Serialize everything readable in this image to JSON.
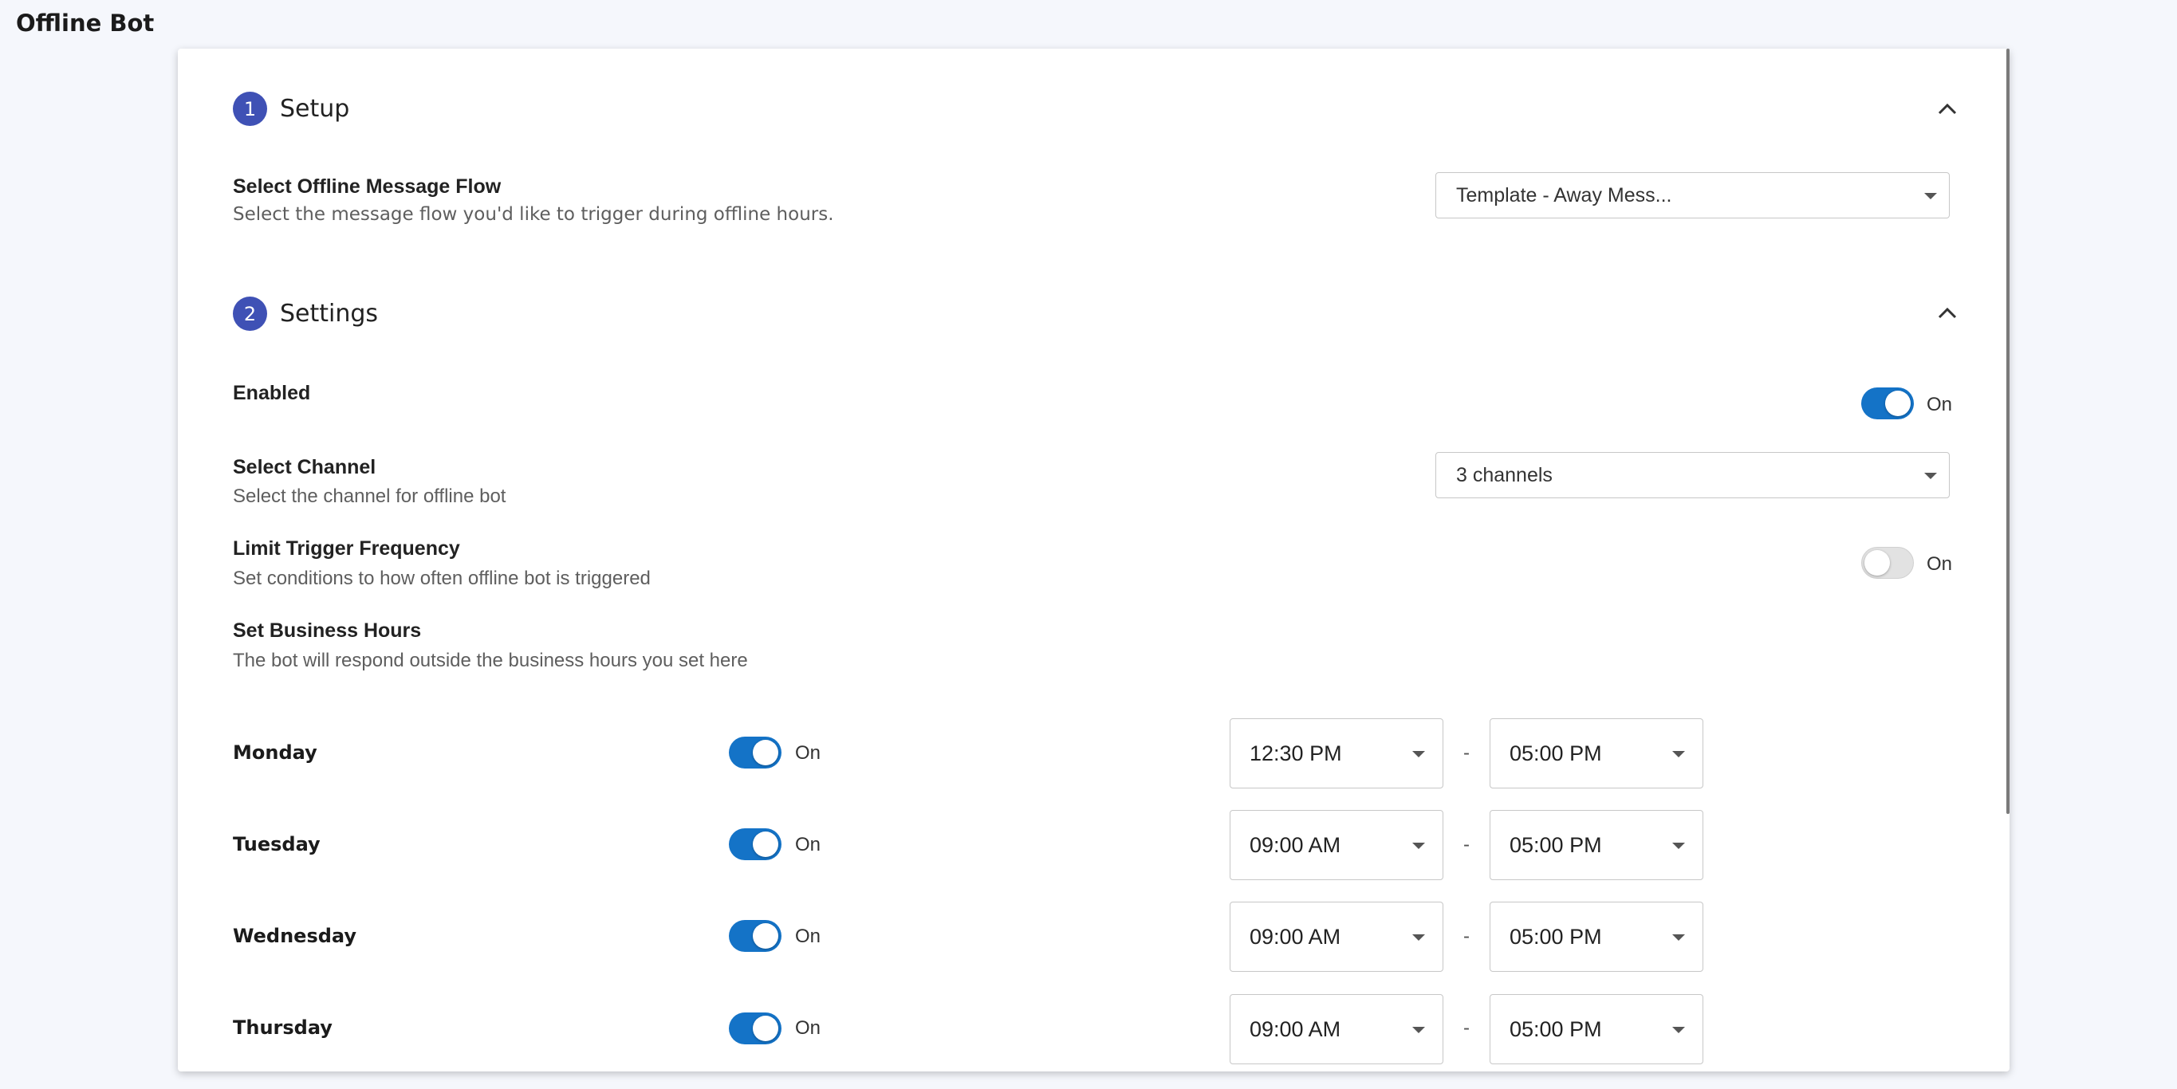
{
  "page": {
    "title": "Offline Bot"
  },
  "sections": [
    {
      "number": "1",
      "title": "Setup",
      "collapse_icon": "chevron-up-icon"
    },
    {
      "number": "2",
      "title": "Settings",
      "collapse_icon": "chevron-up-icon"
    }
  ],
  "setup": {
    "flow_label": "Select Offline Message Flow",
    "flow_desc": "Select the message flow you'd like to trigger during offline hours.",
    "flow_value": "Template - Away Mess..."
  },
  "settings": {
    "enabled_label": "Enabled",
    "enabled_state": "On",
    "channel_label": "Select Channel",
    "channel_desc": "Select the channel for offline bot",
    "channel_value": "3 channels",
    "limit_label": "Limit Trigger Frequency",
    "limit_desc": "Set conditions to how often offline bot is triggered",
    "limit_state": "On",
    "hours_label": "Set Business Hours",
    "hours_desc": "The bot will respond outside the business hours you set here"
  },
  "days": [
    {
      "name": "Monday",
      "state": "On",
      "start": "12:30 PM",
      "end": "05:00 PM",
      "separator": "-"
    },
    {
      "name": "Tuesday",
      "state": "On",
      "start": "09:00 AM",
      "end": "05:00 PM",
      "separator": "-"
    },
    {
      "name": "Wednesday",
      "state": "On",
      "start": "09:00 AM",
      "end": "05:00 PM",
      "separator": "-"
    },
    {
      "name": "Thursday",
      "state": "On",
      "start": "09:00 AM",
      "end": "05:00 PM",
      "separator": "-"
    }
  ],
  "colors": {
    "accent": "#1473c7",
    "section_badge": "#3f51b5",
    "background": "#f5f7fc"
  }
}
